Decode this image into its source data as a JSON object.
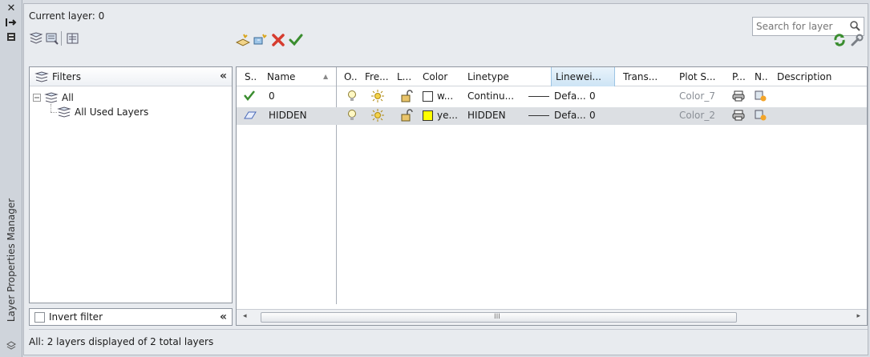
{
  "sidebar": {
    "title": "Layer Properties Manager"
  },
  "header": {
    "current_layer": "Current layer: 0",
    "search_placeholder": "Search for layer"
  },
  "filters": {
    "header": "Filters",
    "tree": [
      {
        "label": "All"
      },
      {
        "label": "All Used Layers"
      }
    ],
    "invert_filter": "Invert filter"
  },
  "table": {
    "columns": [
      "S..",
      "Name",
      "O..",
      "Fre...",
      "L...",
      "Color",
      "Linetype",
      "Linewei...",
      "Trans...",
      "Plot S...",
      "P...",
      "N..",
      "Description"
    ],
    "rows": [
      {
        "name": "0",
        "color_name": "w...",
        "color_hex": "#ffffff",
        "linetype": "Continu...",
        "lineweight": "Defa...",
        "transparency": "0",
        "plot_style": "Color_7"
      },
      {
        "name": "HIDDEN",
        "color_name": "ye...",
        "color_hex": "#ffff00",
        "linetype": "HIDDEN",
        "lineweight": "Defa...",
        "transparency": "0",
        "plot_style": "Color_2"
      }
    ]
  },
  "scrollbar": {
    "grip": "III"
  },
  "status": "All: 2 layers displayed of 2 total layers",
  "colors": {
    "accent": "#3a8d2f",
    "selected_header": "#cde4f5",
    "delete": "#d63c2f"
  }
}
